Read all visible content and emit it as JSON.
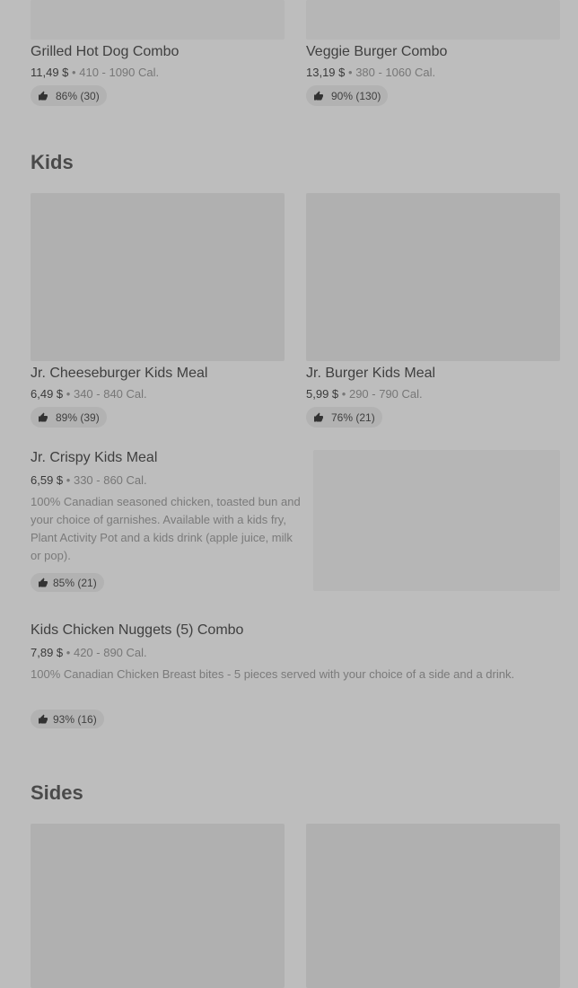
{
  "combos": {
    "items": [
      {
        "title": "Grilled Hot Dog Combo",
        "price": "11,49 $",
        "calories": "410 - 1090 Cal.",
        "rating": "86% (30)"
      },
      {
        "title": "Veggie Burger Combo",
        "price": "13,19 $",
        "calories": "380 - 1060 Cal.",
        "rating": "90% (130)"
      }
    ]
  },
  "kids": {
    "title": "Kids",
    "grid": [
      {
        "title": "Jr. Cheeseburger Kids Meal",
        "price": "6,49 $",
        "calories": "340 - 840 Cal.",
        "rating": "89% (39)"
      },
      {
        "title": "Jr. Burger Kids Meal",
        "price": "5,99 $",
        "calories": "290 - 790 Cal.",
        "rating": "76% (21)"
      }
    ],
    "list": [
      {
        "title": "Jr. Crispy Kids Meal",
        "price": "6,59 $",
        "calories": "330 - 860 Cal.",
        "description": "100% Canadian seasoned chicken, toasted bun and your choice of garnishes. Available with a kids fry, Plant Activity Pot and a kids drink (apple juice, milk or pop).",
        "rating": "85% (21)"
      },
      {
        "title": "Kids Chicken Nuggets (5) Combo",
        "price": "7,89 $",
        "calories": "420 - 890 Cal.",
        "description": "100% Canadian Chicken Breast bites - 5 pieces served with your choice of a side and a drink.",
        "rating": "93% (16)"
      }
    ]
  },
  "sides": {
    "title": "Sides"
  },
  "separator": "•"
}
